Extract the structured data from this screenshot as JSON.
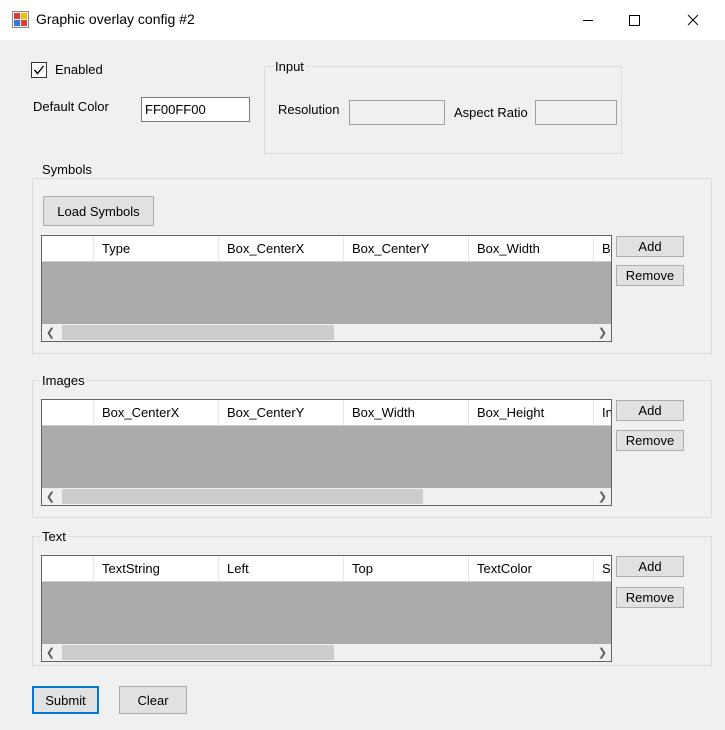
{
  "window": {
    "title": "Graphic overlay config #2",
    "minimize_icon": "minimize-icon",
    "maximize_icon": "maximize-icon",
    "close_icon": "close-icon"
  },
  "general": {
    "enabled_label": "Enabled",
    "enabled_checked": true,
    "default_color_label": "Default Color",
    "default_color_value": "FF00FF00"
  },
  "input_group": {
    "title": "Input",
    "resolution_label": "Resolution",
    "resolution_value": "",
    "aspect_ratio_label": "Aspect Ratio",
    "aspect_ratio_value": ""
  },
  "symbols": {
    "title": "Symbols",
    "load_button": "Load Symbols",
    "columns": [
      "Type",
      "Box_CenterX",
      "Box_CenterY",
      "Box_Width",
      "B"
    ],
    "add_button": "Add",
    "remove_button": "Remove",
    "scroll_fraction": 0.25
  },
  "images": {
    "title": "Images",
    "columns": [
      "Box_CenterX",
      "Box_CenterY",
      "Box_Width",
      "Box_Height",
      "In"
    ],
    "add_button": "Add",
    "remove_button": "Remove"
  },
  "text_group": {
    "title": "Text",
    "columns": [
      "TextString",
      "Left",
      "Top",
      "TextColor",
      "S"
    ],
    "add_button": "Add",
    "remove_button": "Remove"
  },
  "footer": {
    "submit_button": "Submit",
    "clear_button": "Clear"
  },
  "colors": {
    "accent": "#0078d7",
    "grid_background": "#ababab"
  }
}
